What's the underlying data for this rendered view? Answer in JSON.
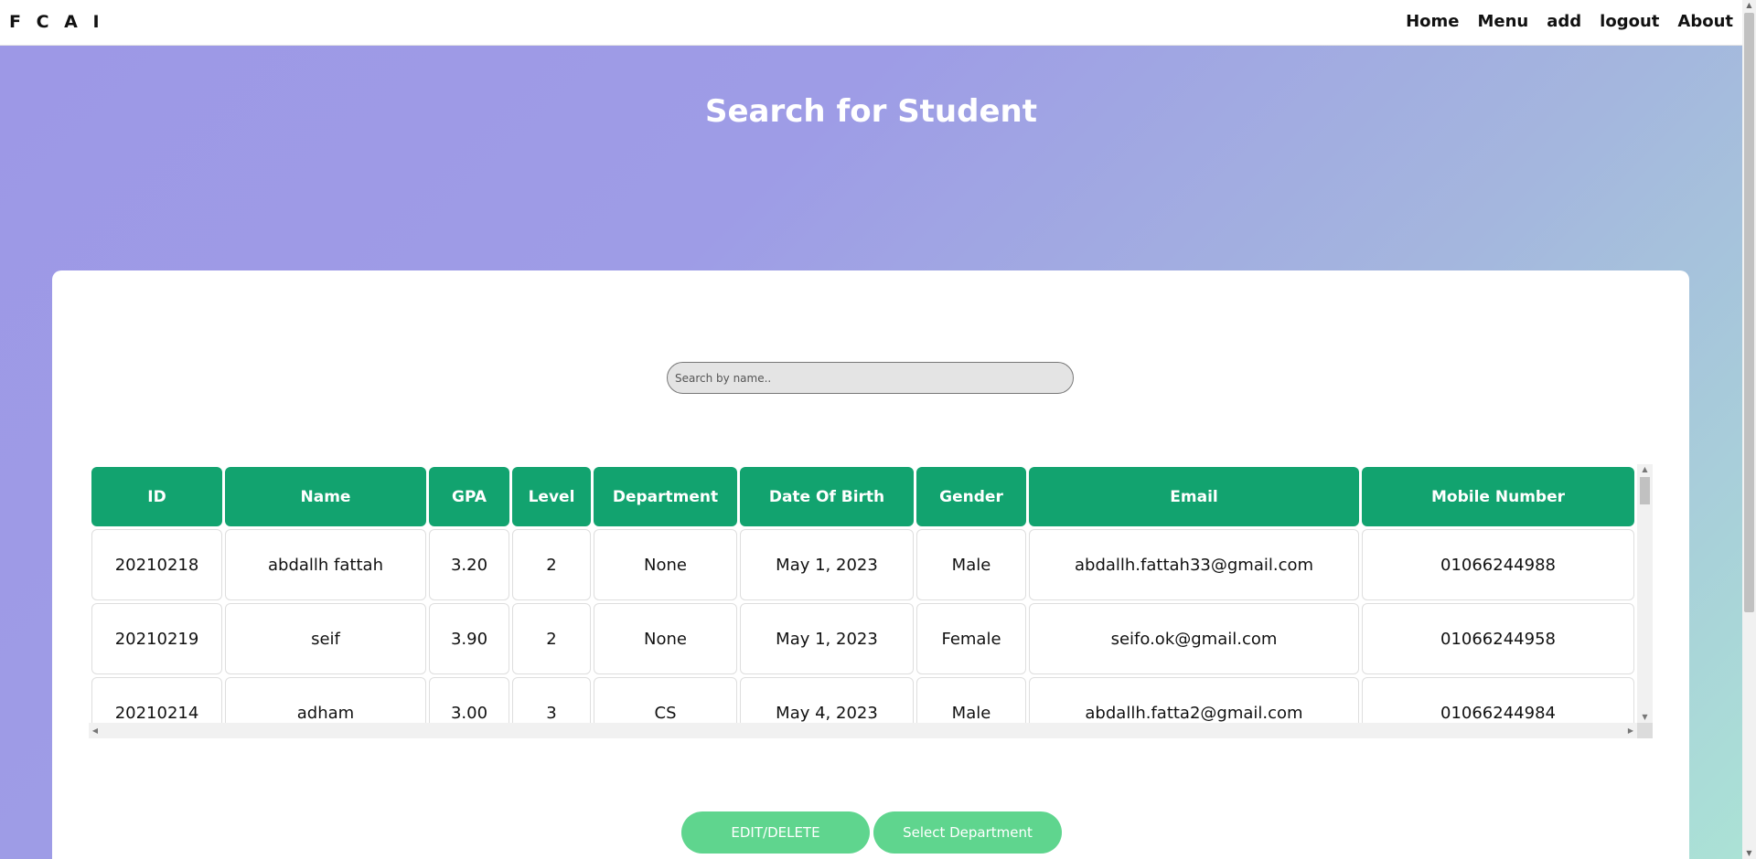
{
  "nav": {
    "logo": "F C A I",
    "links": [
      "Home",
      "Menu",
      "add",
      "logout",
      "About"
    ]
  },
  "page": {
    "title": "Search for Student"
  },
  "search": {
    "placeholder": "Search by name.."
  },
  "table": {
    "headers": [
      "ID",
      "Name",
      "GPA",
      "Level",
      "Department",
      "Date Of Birth",
      "Gender",
      "Email",
      "Mobile Number"
    ],
    "rows": [
      [
        "20210218",
        "abdallh fattah",
        "3.20",
        "2",
        "None",
        "May 1, 2023",
        "Male",
        "abdallh.fattah33@gmail.com",
        "01066244988"
      ],
      [
        "20210219",
        "seif",
        "3.90",
        "2",
        "None",
        "May 1, 2023",
        "Female",
        "seifo.ok@gmail.com",
        "01066244958"
      ],
      [
        "20210214",
        "adham",
        "3.00",
        "3",
        "CS",
        "May 4, 2023",
        "Male",
        "abdallh.fatta2@gmail.com",
        "01066244984"
      ]
    ]
  },
  "actions": {
    "edit_label": "EDIT/DELETE",
    "dept_label": "Select Department"
  },
  "colors": {
    "header_green": "#12a36f",
    "button_green": "#5fd58e"
  }
}
